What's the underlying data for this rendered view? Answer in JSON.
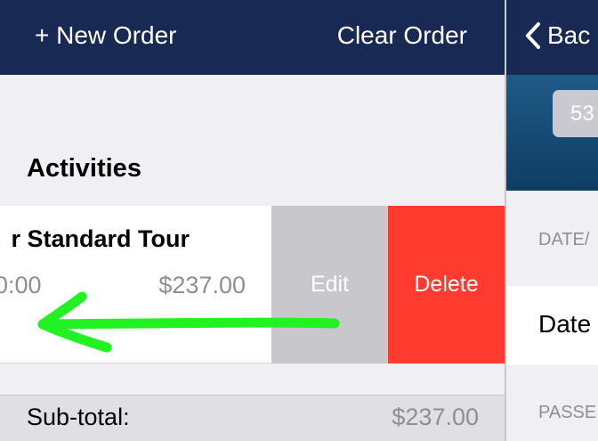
{
  "left": {
    "topbar": {
      "new_order": "+ New Order",
      "clear_order": "Clear Order"
    },
    "section_header": "Activities",
    "activity_row": {
      "title": "r Standard Tour",
      "time": "0:00",
      "price": "$237.00",
      "edit_label": "Edit",
      "delete_label": "Delete"
    },
    "subtotal": {
      "label": "Sub-total:",
      "value": "$237.00"
    }
  },
  "right": {
    "back_label": "Bac",
    "badge": "53",
    "date_section_label": "DATE/",
    "date_cell": "Date",
    "passengers_section_label": "PASSE"
  },
  "colors": {
    "nav_bg": "#182a53",
    "delete_red": "#ff3b30",
    "edit_gray": "#c7c7cc",
    "arrow_green": "#22f222",
    "page_bg": "#efeff4"
  },
  "icons": [
    "chevron-left-icon",
    "swipe-left-arrow-icon"
  ]
}
